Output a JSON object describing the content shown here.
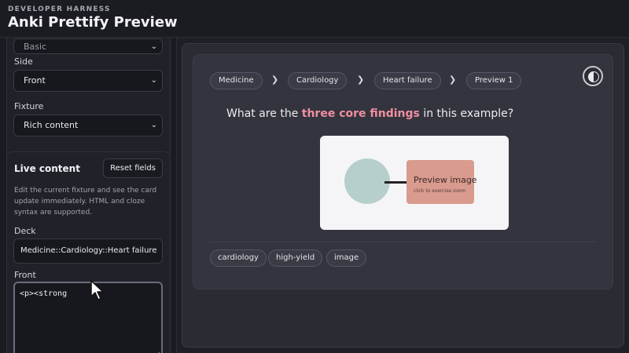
{
  "header": {
    "eyebrow": "DEVELOPER HARNESS",
    "title": "Anki Prettify Preview"
  },
  "sidebar": {
    "note_type_value": "Basic",
    "side": {
      "label": "Side",
      "value": "Front"
    },
    "fixture": {
      "label": "Fixture",
      "value": "Rich content"
    },
    "live": {
      "title": "Live content",
      "reset_label": "Reset fields",
      "help": "Edit the current fixture and see the card update immediately. HTML and cloze syntax are supported.",
      "deck_label": "Deck",
      "deck_value": "Medicine::Cardiology::Heart failure",
      "front_label": "Front",
      "front_value": "<p><strong"
    }
  },
  "card": {
    "breadcrumbs": [
      "Medicine",
      "Cardiology",
      "Heart failure",
      "Preview 1"
    ],
    "question_prefix": "What are the ",
    "question_highlight": "three core findings",
    "question_suffix": " in this example?",
    "figure": {
      "label": "Preview image",
      "sublabel": "click to exercise zoom"
    },
    "tags": [
      "cardiology",
      "high-yield",
      "image"
    ]
  },
  "icons": {
    "chevron": "chevron-down-icon",
    "breadcrumb_sep": "chevron-right-icon",
    "theme": "contrast-icon",
    "cursor": "mouse-pointer-icon"
  },
  "colors": {
    "highlight": "#f08fa0",
    "background": "#1f2027",
    "card": "#33343d"
  }
}
